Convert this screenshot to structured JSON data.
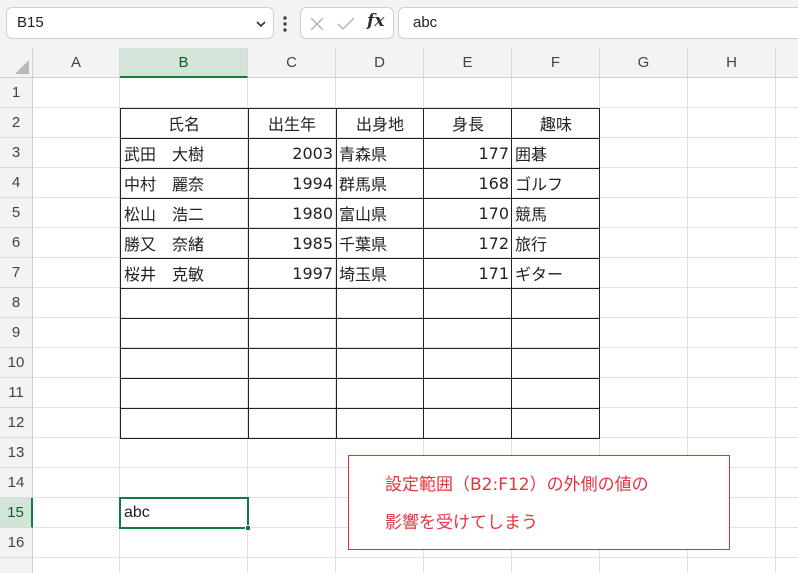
{
  "formula_bar": {
    "name_box": "B15",
    "formula": "abc"
  },
  "icons": {
    "name_box_dropdown": "chevron-down-icon",
    "more": "vertical-ellipsis-icon",
    "cancel": "x-icon",
    "enter": "check-icon",
    "function": "fx-icon"
  },
  "grid": {
    "columns": [
      "A",
      "B",
      "C",
      "D",
      "E",
      "F",
      "G",
      "H"
    ],
    "rows": [
      "1",
      "2",
      "3",
      "4",
      "5",
      "6",
      "7",
      "8",
      "9",
      "10",
      "11",
      "12",
      "13",
      "14",
      "15",
      "16"
    ],
    "active_column": "B",
    "active_row": "15"
  },
  "table": {
    "headers": [
      "氏名",
      "出生年",
      "出身地",
      "身長",
      "趣味"
    ],
    "rows": [
      [
        "武田　大樹",
        "2003",
        "青森県",
        "177",
        "囲碁"
      ],
      [
        "中村　麗奈",
        "1994",
        "群馬県",
        "168",
        "ゴルフ"
      ],
      [
        "松山　浩二",
        "1980",
        "富山県",
        "170",
        "競馬"
      ],
      [
        "勝又　奈緒",
        "1985",
        "千葉県",
        "172",
        "旅行"
      ],
      [
        "桜井　克敏",
        "1997",
        "埼玉県",
        "171",
        "ギター"
      ]
    ]
  },
  "cell_b15": "abc",
  "note": {
    "line1": "設定範囲（B2:F12）の外側の値の",
    "line2": "影響を受けてしまう"
  },
  "colors": {
    "accent": "#107c41",
    "note": "#e53340"
  }
}
